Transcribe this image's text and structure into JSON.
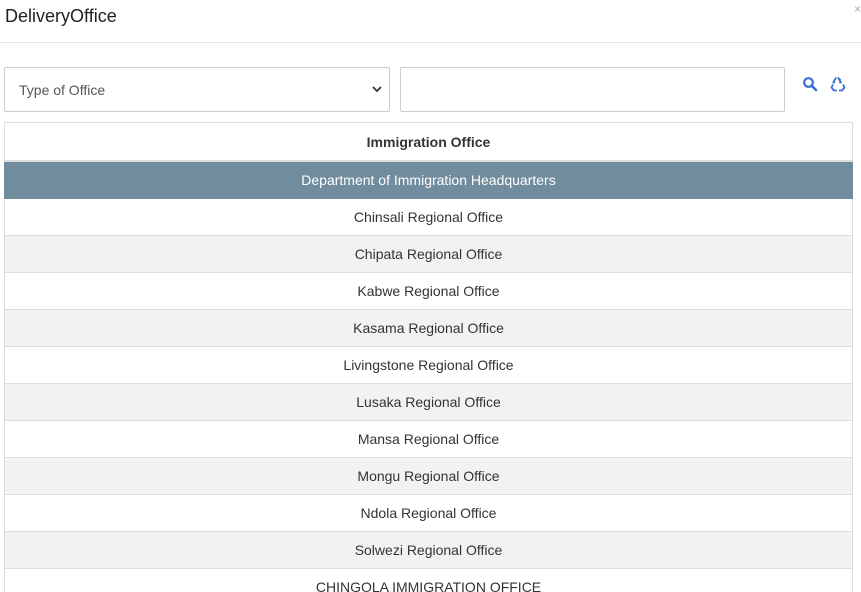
{
  "modal": {
    "title": "DeliveryOffice",
    "close_label": "×"
  },
  "filter": {
    "select_value": "Type of Office",
    "search_value": "",
    "search_icon": "search-icon",
    "reset_icon": "recycle-icon",
    "accent_color": "#3b6fd6"
  },
  "table": {
    "header": "Immigration Office",
    "selected_color": "#708c9d",
    "rows": [
      {
        "name": "Department of Immigration Headquarters",
        "selected": true
      },
      {
        "name": "Chinsali Regional Office"
      },
      {
        "name": "Chipata Regional Office"
      },
      {
        "name": "Kabwe Regional Office"
      },
      {
        "name": "Kasama Regional Office"
      },
      {
        "name": "Livingstone Regional Office"
      },
      {
        "name": "Lusaka Regional Office"
      },
      {
        "name": "Mansa Regional Office"
      },
      {
        "name": "Mongu Regional Office"
      },
      {
        "name": "Ndola Regional Office"
      },
      {
        "name": "Solwezi Regional Office"
      },
      {
        "name": "CHINGOLA IMMIGRATION OFFICE"
      }
    ]
  }
}
